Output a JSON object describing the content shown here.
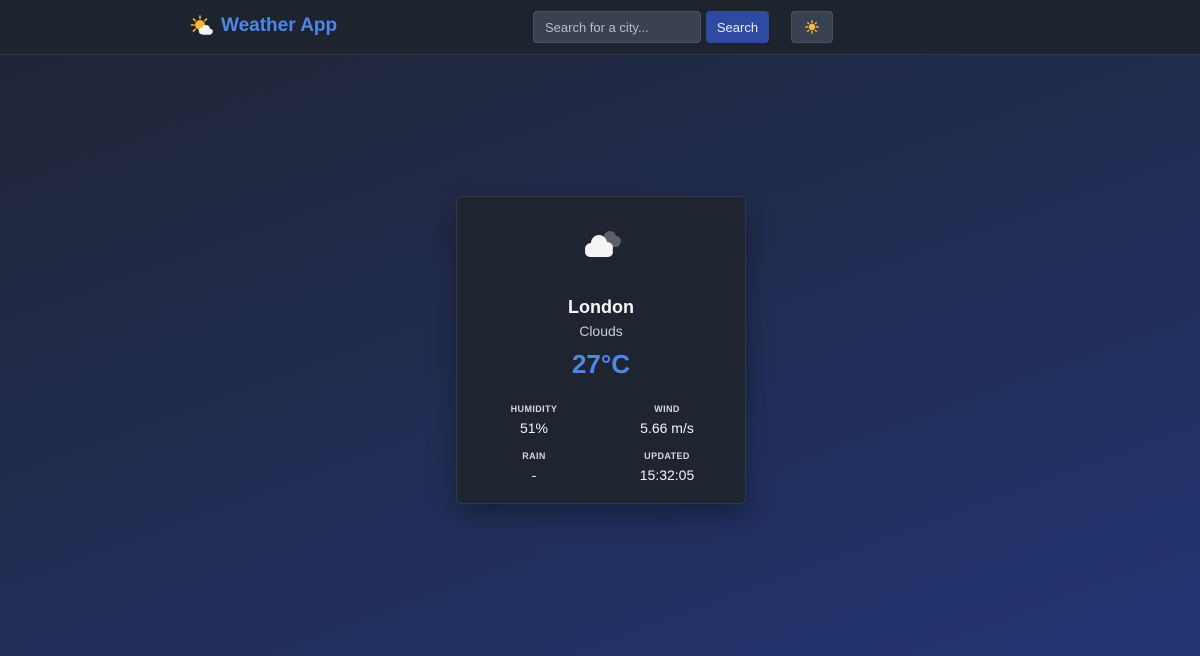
{
  "app": {
    "title": "Weather App",
    "logo_icon": "sun-behind-cloud-icon"
  },
  "search": {
    "placeholder": "Search for a city...",
    "value": "",
    "button_label": "Search"
  },
  "theme_toggle": {
    "icon": "sun-icon"
  },
  "weather": {
    "icon": "cloud-icon",
    "city": "London",
    "condition": "Clouds",
    "temperature": "27°C",
    "stats": {
      "humidity": {
        "label": "HUMIDITY",
        "value": "51%"
      },
      "wind": {
        "label": "WIND",
        "value": "5.66 m/s"
      },
      "rain": {
        "label": "RAIN",
        "value": "-"
      },
      "updated": {
        "label": "UPDATED",
        "value": "15:32:05"
      }
    }
  },
  "colors": {
    "accent": "#4f86e8",
    "search_button": "#2f4aa3",
    "card_bg": "#1f2431",
    "header_bg": "#1e2330"
  }
}
